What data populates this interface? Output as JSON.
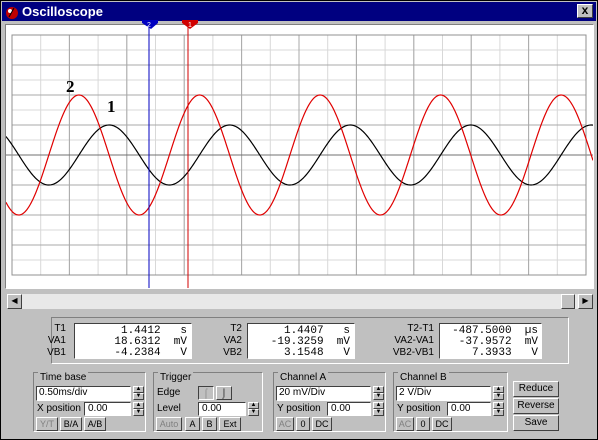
{
  "window": {
    "title": "Oscilloscope",
    "close_label": "x"
  },
  "trace_labels": {
    "trace2": "2",
    "trace1": "1"
  },
  "cursors": {
    "cursor_b": "2",
    "cursor_a": "1",
    "cursor_b_color": "#0000c0",
    "cursor_a_color": "#d00000"
  },
  "chart_data": {
    "type": "line",
    "grid": true,
    "x_divisions": 10,
    "y_divisions": 8,
    "xlim": [
      0,
      5.0
    ],
    "x_unit": "ms",
    "series": [
      {
        "name": "1",
        "color": "#000000",
        "amplitude_div": 1.0,
        "period_div": 2.1,
        "phase_deg": 160,
        "values_unit": "div"
      },
      {
        "name": "2",
        "color": "#e00000",
        "amplitude_div": 2.0,
        "period_div": 2.1,
        "phase_deg": 250,
        "values_unit": "div"
      }
    ]
  },
  "readouts": {
    "col1": {
      "labels": [
        "T1",
        "VA1",
        "VB1"
      ],
      "values": [
        "1.4412   s",
        "18.6312  mV",
        "-4.2384   V"
      ]
    },
    "col2": {
      "labels": [
        "T2",
        "VA2",
        "VB2"
      ],
      "values": [
        "1.4407   s",
        "-19.3259  mV",
        "3.1548   V"
      ]
    },
    "col3": {
      "labels": [
        "T2-T1",
        "VA2-VA1",
        "VB2-VB1"
      ],
      "values": [
        "-487.5000  µs",
        "-37.9572  mV",
        "7.3933   V"
      ]
    }
  },
  "timebase": {
    "title": "Time base",
    "value": "0.50ms/div",
    "xpos_label": "X position",
    "xpos_value": "0.00",
    "btn_yt": "Y/T",
    "btn_ba": "B/A",
    "btn_ab": "A/B"
  },
  "trigger": {
    "title": "Trigger",
    "edge_label": "Edge",
    "level_label": "Level",
    "level_value": "0.00",
    "btn_auto": "Auto",
    "btn_a": "A",
    "btn_b": "B",
    "btn_ext": "Ext"
  },
  "channel_a": {
    "title": "Channel A",
    "value": "20 mV/Div",
    "ypos_label": "Y position",
    "ypos_value": "0.00",
    "btn_ac": "AC",
    "btn_0": "0",
    "btn_dc": "DC"
  },
  "channel_b": {
    "title": "Channel B",
    "value": "2 V/Div",
    "ypos_label": "Y position",
    "ypos_value": "0.00",
    "btn_ac": "AC",
    "btn_0": "0",
    "btn_dc": "DC"
  },
  "actions": {
    "reduce": "Reduce",
    "reverse": "Reverse",
    "save": "Save"
  }
}
